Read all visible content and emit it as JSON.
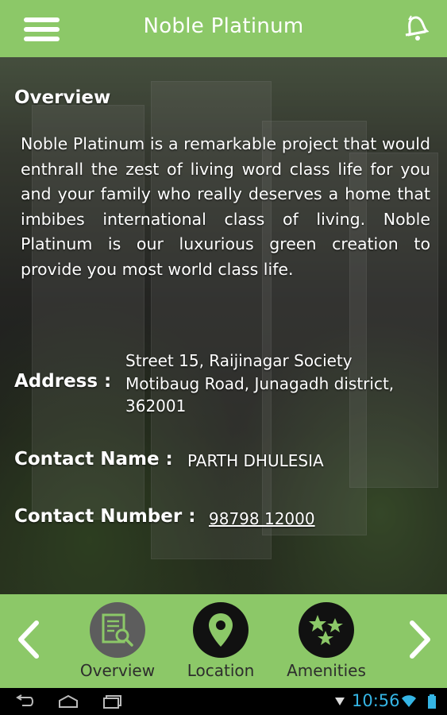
{
  "header": {
    "title": "Noble Platinum",
    "menu_icon": "hamburger-menu-icon",
    "bell_icon": "bell-icon"
  },
  "overview": {
    "heading": "Overview",
    "body": "Noble Platinum is a remarkable project that would enthrall the zest of living word class life for you and your family who really deserves a home that imbibes international class of living. Noble Platinum is our luxurious green creation to provide you most world class life."
  },
  "address": {
    "label": "Address :",
    "line1": "Street 15, Raijinagar Society",
    "line2": "Motibaug Road, Junagadh district,",
    "line3": "362001"
  },
  "contact_name": {
    "label": "Contact Name :",
    "value": "PARTH DHULESIA"
  },
  "contact_number": {
    "label": "Contact Number :",
    "value": "98798 12000"
  },
  "bottom_nav": {
    "items": [
      {
        "label": "Overview",
        "icon": "document-search-icon",
        "active": true
      },
      {
        "label": "Location",
        "icon": "map-pin-icon",
        "active": false
      },
      {
        "label": "Amenities",
        "icon": "stars-icon",
        "active": false
      }
    ],
    "prev_icon": "chevron-left-icon",
    "next_icon": "chevron-right-icon"
  },
  "status_bar": {
    "time": "10:56"
  },
  "colors": {
    "accent": "#8cc868",
    "clock": "#35b5e5"
  }
}
